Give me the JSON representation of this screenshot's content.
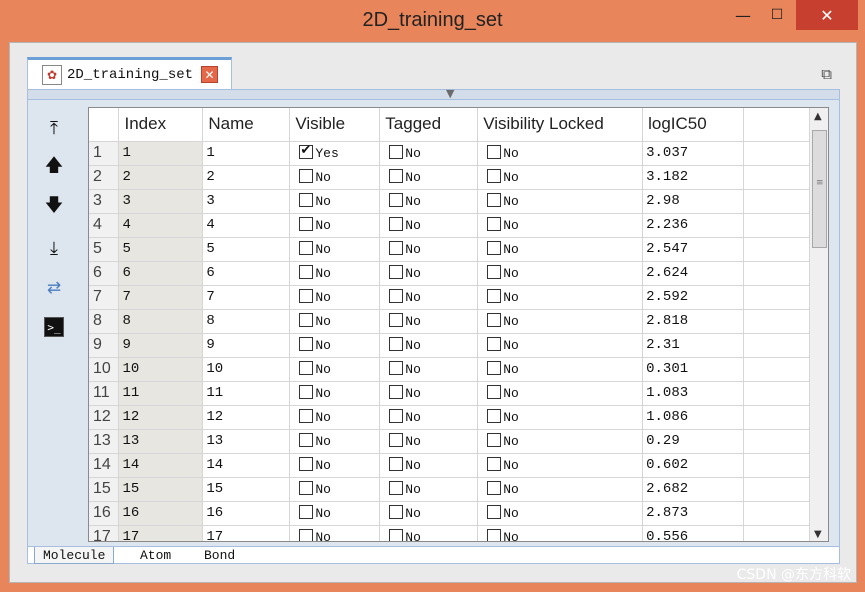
{
  "window": {
    "title": "2D_training_set",
    "minimize_glyph": "—",
    "maximize_glyph": "☐",
    "close_glyph": "✕"
  },
  "tab": {
    "label": "2D_training_set",
    "icon": "molecule-icon",
    "close_glyph": "✕"
  },
  "toolbar": {
    "icons": [
      "move-to-top-icon",
      "move-up-icon",
      "move-down-icon",
      "move-to-bottom-icon",
      "sync-icon",
      "console-icon"
    ]
  },
  "grid": {
    "columns": [
      "Index",
      "Name",
      "Visible",
      "Tagged",
      "Visibility Locked",
      "logIC50"
    ],
    "rows": [
      {
        "row": "1",
        "index": "1",
        "name": "1",
        "visible": "Yes",
        "visible_checked": true,
        "tagged": "No",
        "locked": "No",
        "logic50": "3.037"
      },
      {
        "row": "2",
        "index": "2",
        "name": "2",
        "visible": "No",
        "visible_checked": false,
        "tagged": "No",
        "locked": "No",
        "logic50": "3.182"
      },
      {
        "row": "3",
        "index": "3",
        "name": "3",
        "visible": "No",
        "visible_checked": false,
        "tagged": "No",
        "locked": "No",
        "logic50": "2.98"
      },
      {
        "row": "4",
        "index": "4",
        "name": "4",
        "visible": "No",
        "visible_checked": false,
        "tagged": "No",
        "locked": "No",
        "logic50": "2.236"
      },
      {
        "row": "5",
        "index": "5",
        "name": "5",
        "visible": "No",
        "visible_checked": false,
        "tagged": "No",
        "locked": "No",
        "logic50": "2.547"
      },
      {
        "row": "6",
        "index": "6",
        "name": "6",
        "visible": "No",
        "visible_checked": false,
        "tagged": "No",
        "locked": "No",
        "logic50": "2.624"
      },
      {
        "row": "7",
        "index": "7",
        "name": "7",
        "visible": "No",
        "visible_checked": false,
        "tagged": "No",
        "locked": "No",
        "logic50": "2.592"
      },
      {
        "row": "8",
        "index": "8",
        "name": "8",
        "visible": "No",
        "visible_checked": false,
        "tagged": "No",
        "locked": "No",
        "logic50": "2.818"
      },
      {
        "row": "9",
        "index": "9",
        "name": "9",
        "visible": "No",
        "visible_checked": false,
        "tagged": "No",
        "locked": "No",
        "logic50": "2.31"
      },
      {
        "row": "10",
        "index": "10",
        "name": "10",
        "visible": "No",
        "visible_checked": false,
        "tagged": "No",
        "locked": "No",
        "logic50": "0.301"
      },
      {
        "row": "11",
        "index": "11",
        "name": "11",
        "visible": "No",
        "visible_checked": false,
        "tagged": "No",
        "locked": "No",
        "logic50": "1.083"
      },
      {
        "row": "12",
        "index": "12",
        "name": "12",
        "visible": "No",
        "visible_checked": false,
        "tagged": "No",
        "locked": "No",
        "logic50": "1.086"
      },
      {
        "row": "13",
        "index": "13",
        "name": "13",
        "visible": "No",
        "visible_checked": false,
        "tagged": "No",
        "locked": "No",
        "logic50": "0.29"
      },
      {
        "row": "14",
        "index": "14",
        "name": "14",
        "visible": "No",
        "visible_checked": false,
        "tagged": "No",
        "locked": "No",
        "logic50": "0.602"
      },
      {
        "row": "15",
        "index": "15",
        "name": "15",
        "visible": "No",
        "visible_checked": false,
        "tagged": "No",
        "locked": "No",
        "logic50": "2.682"
      },
      {
        "row": "16",
        "index": "16",
        "name": "16",
        "visible": "No",
        "visible_checked": false,
        "tagged": "No",
        "locked": "No",
        "logic50": "2.873"
      },
      {
        "row": "17",
        "index": "17",
        "name": "17",
        "visible": "No",
        "visible_checked": false,
        "tagged": "No",
        "locked": "No",
        "logic50": "0.556"
      }
    ]
  },
  "bottom_tabs": [
    "Molecule",
    "Atom",
    "Bond"
  ],
  "watermark": "CSDN @东方科软"
}
